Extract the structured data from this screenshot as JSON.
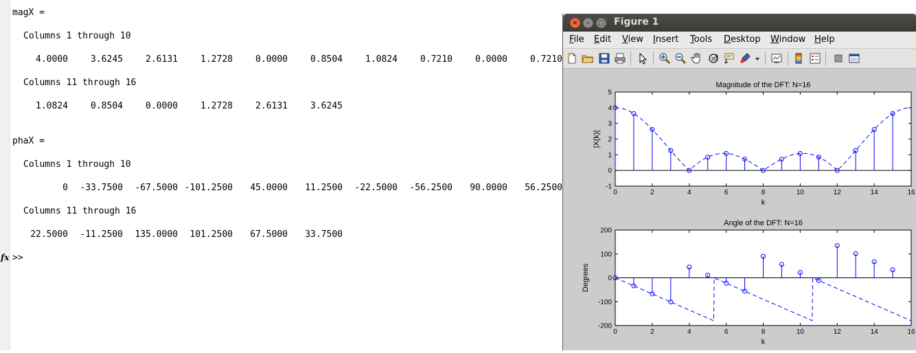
{
  "console": {
    "magX_header": "magX =",
    "cols_1_10": "Columns 1 through 10",
    "cols_11_16": "Columns 11 through 16",
    "magX_row1": [
      "4.0000",
      "3.6245",
      "2.6131",
      "1.2728",
      "0.0000",
      "0.8504",
      "1.0824",
      "0.7210",
      "0.0000",
      "0.7210"
    ],
    "magX_row2": [
      "1.0824",
      "0.8504",
      "0.0000",
      "1.2728",
      "2.6131",
      "3.6245"
    ],
    "phaX_header": "phaX =",
    "phaX_row1": [
      "0",
      "-33.7500",
      "-67.5000",
      "-101.2500",
      "45.0000",
      "11.2500",
      "-22.5000",
      "-56.2500",
      "90.0000",
      "56.2500"
    ],
    "phaX_row2": [
      "22.5000",
      "-11.2500",
      "135.0000",
      "101.2500",
      "67.5000",
      "33.7500"
    ],
    "fx_icon": "fx",
    "prompt": ">>"
  },
  "figure": {
    "window_title": "Figure 1",
    "menus": [
      "File",
      "Edit",
      "View",
      "Insert",
      "Tools",
      "Desktop",
      "Window",
      "Help"
    ],
    "toolbar_icons": [
      "new-figure-icon",
      "open-file-icon",
      "save-icon",
      "print-icon",
      "pointer-icon",
      "zoom-in-icon",
      "zoom-out-icon",
      "pan-hand-icon",
      "rotate-3d-icon",
      "data-cursor-icon",
      "brush-icon",
      "dropdown-arrow-icon",
      "link-plot-icon",
      "colorbar-icon",
      "legend-icon",
      "hide-plot-tools-icon",
      "show-plot-tools-icon"
    ]
  },
  "colors": {
    "stem": "#0000ff",
    "titlebar": "#3c3b37",
    "close_button": "#f36b3a"
  },
  "chart_data": [
    {
      "type": "stem",
      "title": "Magnitude of the DFT: N=16",
      "xlabel": "k",
      "ylabel": "|X(k)|",
      "xlim": [
        0,
        16
      ],
      "ylim": [
        -1,
        5
      ],
      "xticks": [
        0,
        2,
        4,
        6,
        8,
        10,
        12,
        14,
        16
      ],
      "yticks": [
        -1,
        0,
        1,
        2,
        3,
        4,
        5
      ],
      "x": [
        0,
        1,
        2,
        3,
        4,
        5,
        6,
        7,
        8,
        9,
        10,
        11,
        12,
        13,
        14,
        15
      ],
      "values": [
        4.0,
        3.6245,
        2.6131,
        1.2728,
        0.0,
        0.8504,
        1.0824,
        0.721,
        0.0,
        0.721,
        1.0824,
        0.8504,
        0.0,
        1.2728,
        2.6131,
        3.6245
      ],
      "envelope": "dashed continuous magnitude |sin(w*4/2)/sin(w/2)| over k=0..16"
    },
    {
      "type": "stem",
      "title": "Angle of the DFT: N=16",
      "xlabel": "k",
      "ylabel": "Degrees",
      "xlim": [
        0,
        16
      ],
      "ylim": [
        -200,
        200
      ],
      "xticks": [
        0,
        2,
        4,
        6,
        8,
        10,
        12,
        14,
        16
      ],
      "yticks": [
        -200,
        -100,
        0,
        100,
        200
      ],
      "x": [
        0,
        1,
        2,
        3,
        4,
        5,
        6,
        7,
        8,
        9,
        10,
        11,
        12,
        13,
        14,
        15
      ],
      "values": [
        0,
        -33.75,
        -67.5,
        -101.25,
        45.0,
        11.25,
        -22.5,
        -56.25,
        90.0,
        56.25,
        22.5,
        -11.25,
        135.0,
        101.25,
        67.5,
        33.75
      ],
      "envelope": "dashed continuous phase, sawtooth with jumps at k=4, 8, 12"
    }
  ]
}
